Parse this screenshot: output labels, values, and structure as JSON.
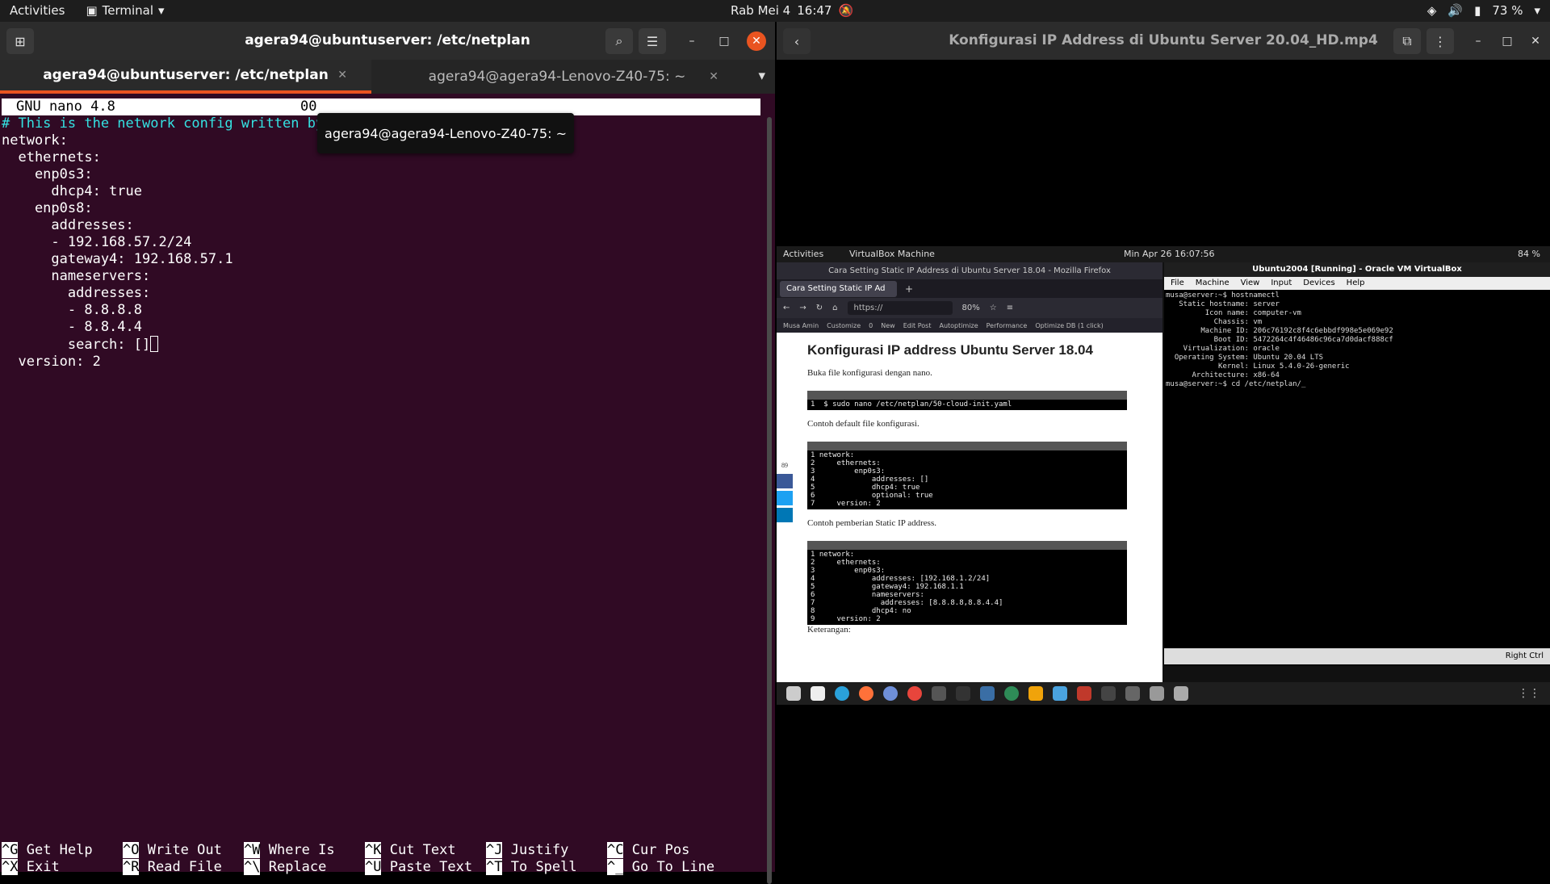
{
  "topbar": {
    "activities": "Activities",
    "app_menu": "Terminal",
    "clock_date": "Rab Mei 4",
    "clock_time": "16:47",
    "battery": "73 %"
  },
  "terminal": {
    "title": "agera94@ubuntuserver: /etc/netplan",
    "tabs": [
      {
        "label": "agera94@ubuntuserver: /etc/netplan"
      },
      {
        "label": "agera94@agera94-Lenovo-Z40-75: ~"
      }
    ],
    "tooltip": "agera94@agera94-Lenovo-Z40-75: ~",
    "nano_header": "GNU nano 4.8",
    "nano_header_right": "00",
    "lines": [
      "# This is the network config written by",
      "network:",
      "  ethernets:",
      "    enp0s3:",
      "      dhcp4: true",
      "    enp0s8:",
      "      addresses:",
      "      - 192.168.57.2/24",
      "      gateway4: 192.168.57.1",
      "      nameservers:",
      "        addresses:",
      "        - 8.8.8.8",
      "        - 8.8.4.4",
      "        search: []",
      "  version: 2"
    ],
    "shortcuts": [
      {
        "key": "^G",
        "label": "Get Help"
      },
      {
        "key": "^O",
        "label": "Write Out"
      },
      {
        "key": "^W",
        "label": "Where Is"
      },
      {
        "key": "^K",
        "label": "Cut Text"
      },
      {
        "key": "^J",
        "label": "Justify"
      },
      {
        "key": "^C",
        "label": "Cur Pos"
      },
      {
        "key": "^X",
        "label": "Exit"
      },
      {
        "key": "^R",
        "label": "Read File"
      },
      {
        "key": "^\\",
        "label": "Replace"
      },
      {
        "key": "^U",
        "label": "Paste Text"
      },
      {
        "key": "^T",
        "label": "To Spell"
      },
      {
        "key": "^_",
        "label": "Go To Line"
      }
    ]
  },
  "video": {
    "title": "Konfigurasi IP Address di Ubuntu Server 20.04_HD.mp4",
    "inner_topbar": {
      "activities": "Activities",
      "app": "VirtualBox Machine",
      "clock": "Min Apr 26  16:07:56",
      "battery": "84 %"
    },
    "firefox": {
      "title": "Cara Setting Static IP Address di Ubuntu Server 18.04 - Mozilla Firefox",
      "tab": "Cara Setting Static IP Ad",
      "url": "https://",
      "zoom": "80%",
      "bookmarks": [
        "Musa Amin",
        "Customize",
        "0",
        "New",
        "Edit Post",
        "Autoptimize",
        "Performance",
        "Optimize DB (1 click)"
      ],
      "heading": "Konfigurasi IP address Ubuntu Server 18.04",
      "p1": "Buka file konfigurasi dengan nano.",
      "code1": "1  $ sudo nano /etc/netplan/50-cloud-init.yaml",
      "p2": "Contoh default file konfigurasi.",
      "code2": "1 network:\n2     ethernets:\n3         enp0s3:\n4             addresses: []\n5             dhcp4: true\n6             optional: true\n7     version: 2",
      "p3": "Contoh pemberian Static IP address.",
      "code3": "1 network:\n2     ethernets:\n3         enp0s3:\n4             addresses: [192.168.1.2/24]\n5             gateway4: 192.168.1.1\n6             nameservers:\n7               addresses: [8.8.8.8,8.8.4.4]\n8             dhcp4: no\n9     version: 2",
      "p4": "Keterangan:",
      "shares": "89"
    },
    "virtualbox": {
      "title": "Ubuntu2004 [Running] - Oracle VM VirtualBox",
      "menu": [
        "File",
        "Machine",
        "View",
        "Input",
        "Devices",
        "Help"
      ],
      "console": "musa@server:~$ hostnamectl\n   Static hostname: server\n         Icon name: computer-vm\n           Chassis: vm\n        Machine ID: 206c76192c8f4c6ebbdf998e5e069e92\n           Boot ID: 5472264c4f46486c96ca7d0dacf888cf\n    Virtualization: oracle\n  Operating System: Ubuntu 20.04 LTS\n            Kernel: Linux 5.4.0-26-generic\n      Architecture: x86-64\nmusa@server:~$ cd /etc/netplan/_",
      "status": "Right Ctrl"
    }
  }
}
